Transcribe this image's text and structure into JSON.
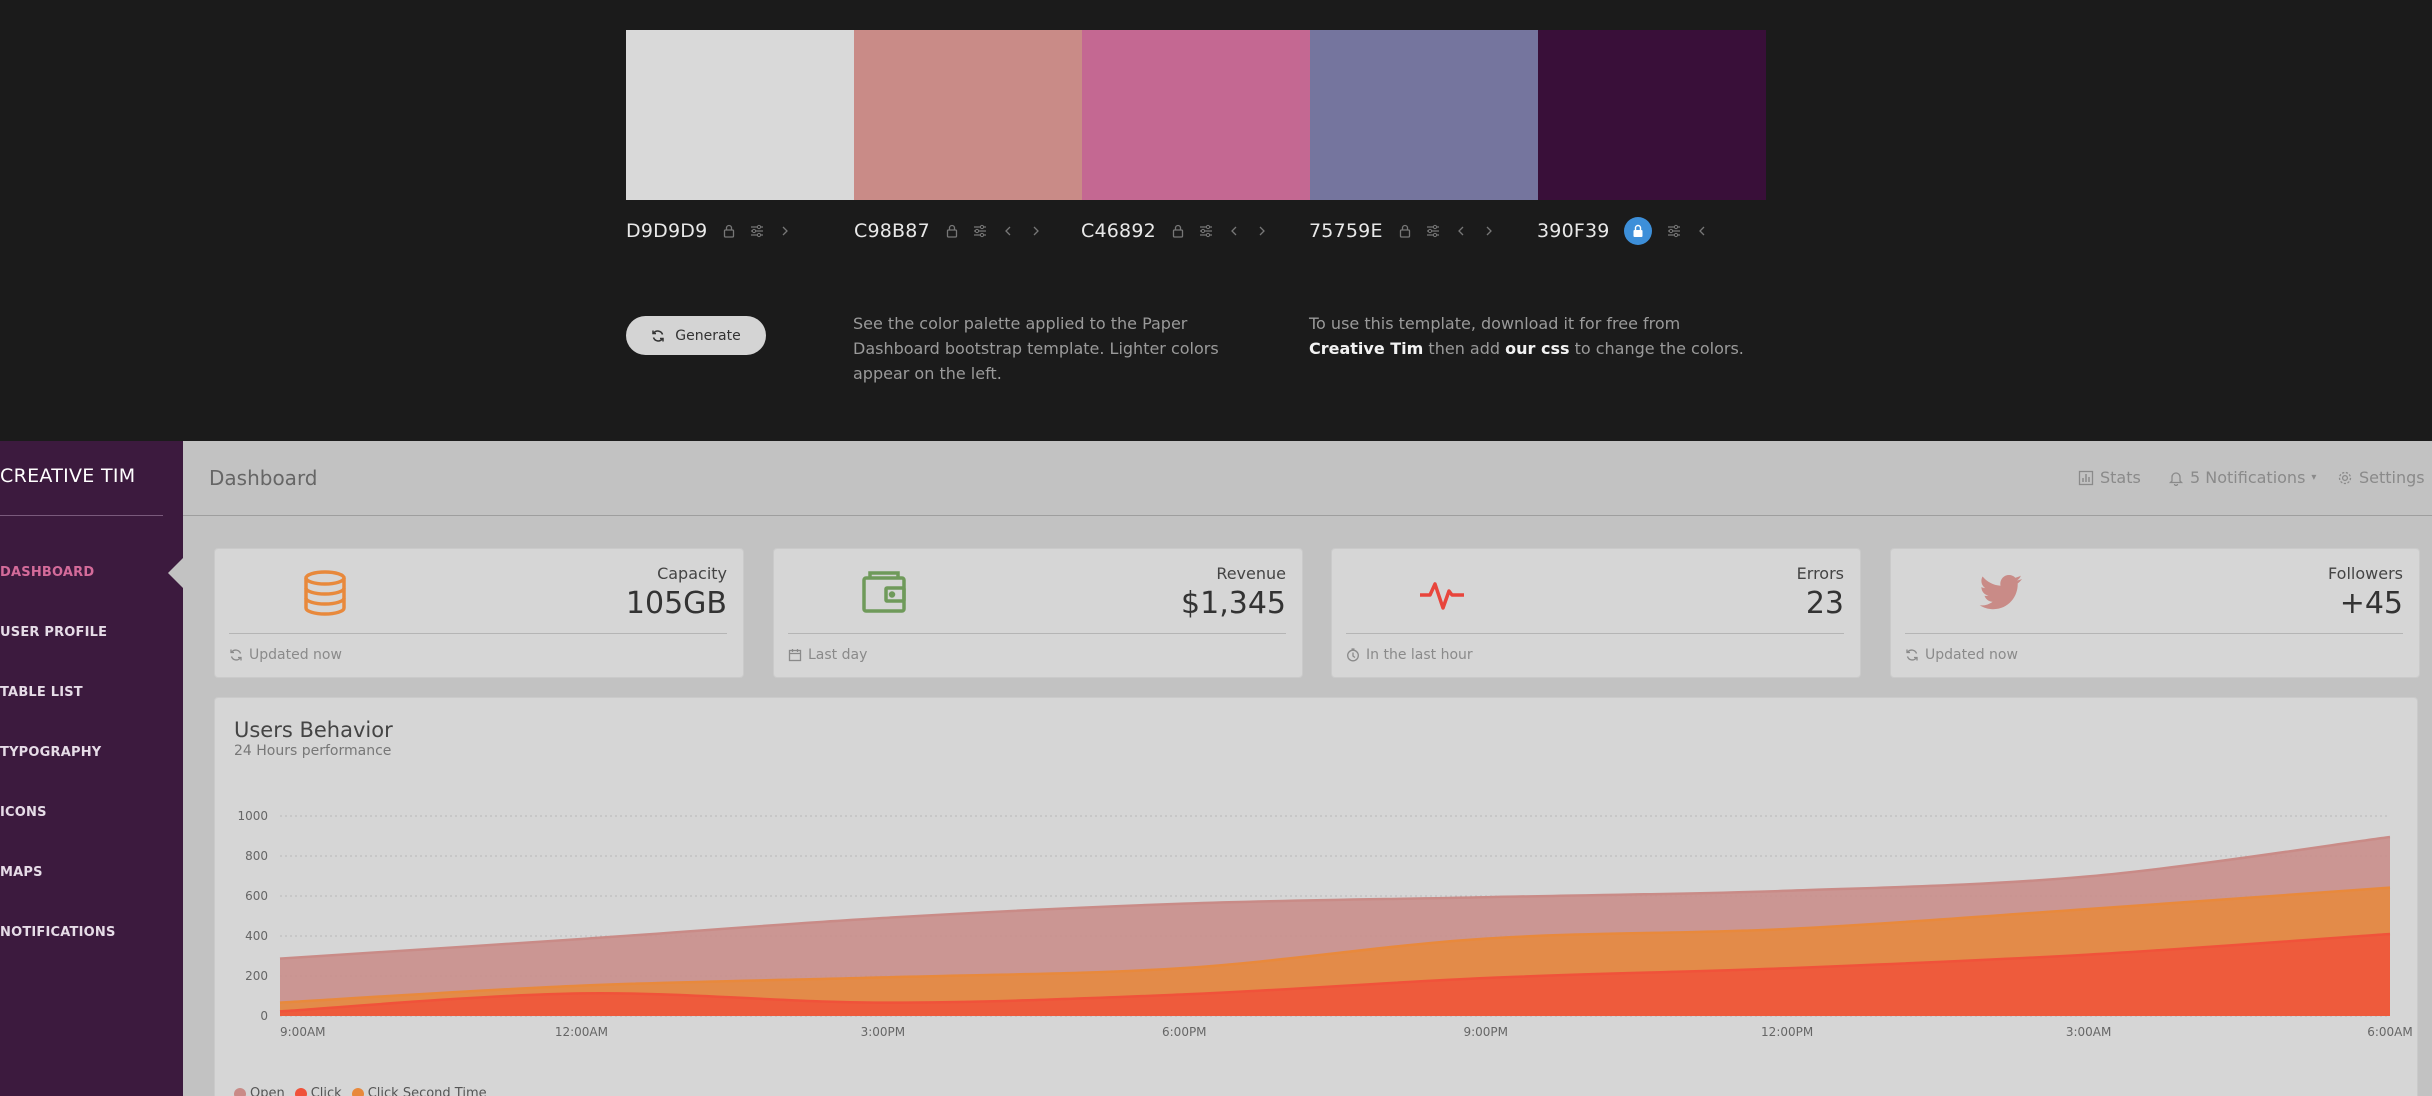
{
  "palette": {
    "swatches": [
      {
        "hex": "D9D9D9",
        "color": "#d9d9d9",
        "locked": false
      },
      {
        "hex": "C98B87",
        "color": "#c98b87",
        "locked": false
      },
      {
        "hex": "C46892",
        "color": "#c46892",
        "locked": false
      },
      {
        "hex": "75759E",
        "color": "#75759e",
        "locked": false
      },
      {
        "hex": "390F39",
        "color": "#390f39",
        "locked": true
      }
    ],
    "generate_label": "Generate",
    "info_left": "See the color palette applied to the Paper Dashboard bootstrap template. Lighter colors appear on the left.",
    "info_right_pre": "To use this template, download it for free from ",
    "info_right_link1": "Creative Tim",
    "info_right_mid": " then add ",
    "info_right_link2": "our css",
    "info_right_post": " to change the colors."
  },
  "dashboard": {
    "brand": "CREATIVE TIM",
    "nav": [
      {
        "label": "DASHBOARD",
        "active": true
      },
      {
        "label": "USER PROFILE",
        "active": false
      },
      {
        "label": "TABLE LIST",
        "active": false
      },
      {
        "label": "TYPOGRAPHY",
        "active": false
      },
      {
        "label": "ICONS",
        "active": false
      },
      {
        "label": "MAPS",
        "active": false
      },
      {
        "label": "NOTIFICATIONS",
        "active": false
      }
    ],
    "page_title": "Dashboard",
    "top_links": {
      "stats": "Stats",
      "notifications": "5 Notifications",
      "settings": "Settings"
    },
    "cards": [
      {
        "label": "Capacity",
        "value": "105GB",
        "footer": "Updated now",
        "icon": "database-icon",
        "color": "#e8893c",
        "footer_icon": "refresh-icon"
      },
      {
        "label": "Revenue",
        "value": "$1,345",
        "footer": "Last day",
        "icon": "wallet-icon",
        "color": "#6f9a5a",
        "footer_icon": "calendar-icon"
      },
      {
        "label": "Errors",
        "value": "23",
        "footer": "In the last hour",
        "icon": "pulse-icon",
        "color": "#e8453c",
        "footer_icon": "clock-icon"
      },
      {
        "label": "Followers",
        "value": "+45",
        "footer": "Updated now",
        "icon": "twitter-icon",
        "color": "#c98b87",
        "footer_icon": "refresh-icon"
      }
    ],
    "chart_title": "Users Behavior",
    "chart_subtitle": "24 Hours performance"
  },
  "chart_data": {
    "type": "area",
    "title": "Users Behavior",
    "subtitle": "24 Hours performance",
    "x": [
      "9:00AM",
      "12:00AM",
      "3:00PM",
      "6:00PM",
      "9:00PM",
      "12:00PM",
      "3:00AM",
      "6:00AM"
    ],
    "ylim": [
      0,
      1000
    ],
    "yticks": [
      0,
      200,
      400,
      600,
      800,
      1000
    ],
    "series": [
      {
        "name": "Open",
        "color": "#c98b87",
        "values": [
          287,
          385,
          490,
          562,
          594,
          626,
          698,
          895
        ]
      },
      {
        "name": "Click Second Time",
        "color": "#e8893c",
        "values": [
          67,
          152,
          193,
          240,
          387,
          435,
          535,
          642
        ]
      },
      {
        "name": "Click",
        "color": "#f0523a",
        "values": [
          23,
          113,
          67,
          108,
          190,
          239,
          307,
          410
        ]
      }
    ],
    "grid": true,
    "legend": "bottom-left"
  }
}
